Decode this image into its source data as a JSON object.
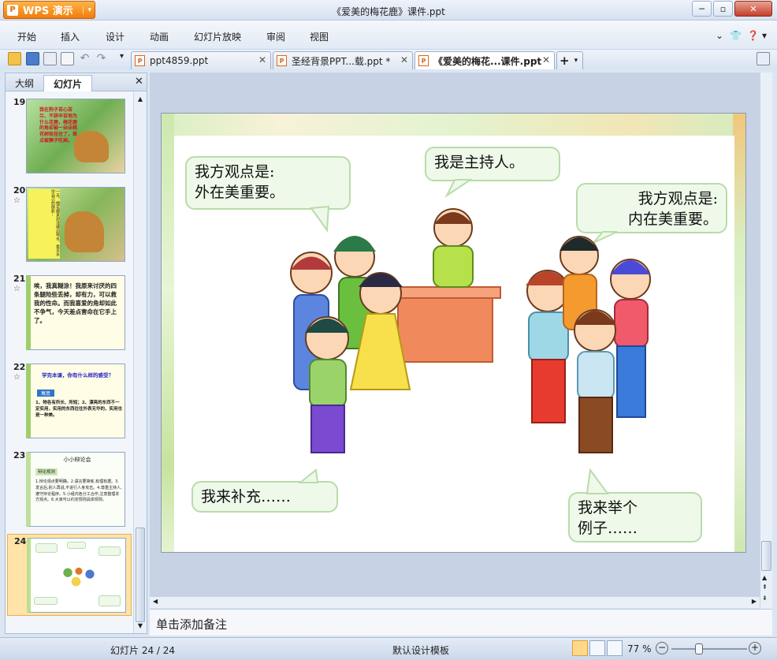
{
  "app": {
    "name": "WPS 演示",
    "window_title": "《爱美的梅花鹿》课件.ppt"
  },
  "menu": [
    "开始",
    "插入",
    "设计",
    "动画",
    "幻灯片放映",
    "审阅",
    "视图"
  ],
  "doc_tabs": [
    {
      "label": "ppt4859.ppt",
      "active": false
    },
    {
      "label": "圣经背景PPT...载.ppt *",
      "active": false
    },
    {
      "label": "《爱美的梅花...课件.ppt",
      "active": true
    }
  ],
  "panel_tabs": [
    "大纲",
    "幻灯片"
  ],
  "thumbnails": [
    {
      "num": "19",
      "star": "",
      "text": "我在狗子苦心苦兰、不辞辛苦地为什么花鹿，梅花鹿的角却被一朵朵桃花树枝挂住了，差点被狮子吃掉。"
    },
    {
      "num": "20",
      "star": "☆",
      "text": "一天，梅花鹿来到池塘边喝水，看见水中自己的倒影..."
    },
    {
      "num": "21",
      "star": "☆",
      "text": "唉，我真糊涂！我原来讨厌的四条腿险些丢掉，却有力，可以救我的性命。而我喜爱的角却如此不争气，今天差点害命在它手上了。"
    },
    {
      "num": "22",
      "star": "☆",
      "title": "学完本课，你有什么样的感受？",
      "tag": "寓意",
      "text": "1、物各有所长、所短；2、漂亮的东西不一定实用，实用的东西往往外表无华的，实用也是一种美。"
    },
    {
      "num": "23",
      "star": "",
      "title": "小小辩论会",
      "sub": "辩论规则",
      "text": "1.辩论观点要明确。2.语言要简练,有理有据。3.发言后,别人再说,不进行人身攻击。4.尊重主持人,遵守辩论程序。5.小组内各分工合作,注意整理本方观点。6.大家可以约定规则具体规则。"
    },
    {
      "num": "24",
      "star": "",
      "text": ""
    }
  ],
  "slide": {
    "bubbles": {
      "top_left": "我方观点是:\n外在美重要。",
      "top_center": "我是主持人。",
      "top_right": "我方观点是:\n内在美重要。",
      "bottom_left": "我来补充……",
      "bottom_right": "我来举个\n例子……"
    }
  },
  "notes_placeholder": "单击添加备注",
  "status": {
    "slide_count": "幻灯片 24 / 24",
    "template": "默认设计模板",
    "zoom": "77 %",
    "zoom_level_percent": 77
  },
  "colors": {
    "accent": "#f08a1c",
    "tabbar": "#d8e3f1",
    "slide_bubble_bg": "#eef9ea",
    "slide_bubble_border": "#b9dcaa"
  },
  "icons": [
    "open-icon",
    "save-icon",
    "print-icon",
    "print-preview-icon",
    "undo-icon",
    "redo-icon",
    "new-tab-icon",
    "help-icon"
  ]
}
